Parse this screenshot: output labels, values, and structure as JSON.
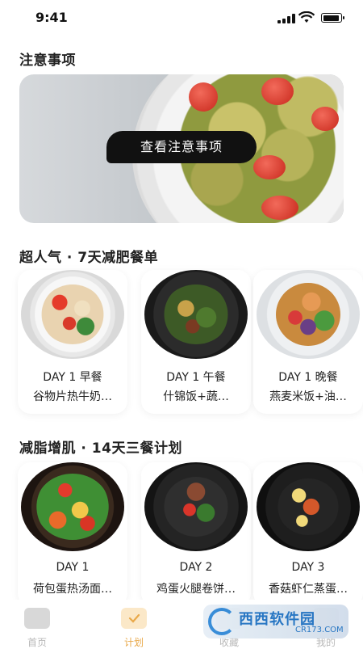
{
  "status": {
    "time": "9:41"
  },
  "notice": {
    "title": "注意事项",
    "button": "查看注意事项"
  },
  "section1": {
    "title": "超人气 · 7天减肥餐单",
    "cards": [
      {
        "day": "DAY 1 早餐",
        "desc": "谷物片热牛奶…"
      },
      {
        "day": "DAY 1 午餐",
        "desc": "什锦饭+蔬…"
      },
      {
        "day": "DAY 1 晚餐",
        "desc": "燕麦米饭+油…"
      }
    ]
  },
  "section2": {
    "title": "减脂增肌 · 14天三餐计划",
    "cards": [
      {
        "day": "DAY 1",
        "desc": "荷包蛋热汤面…"
      },
      {
        "day": "DAY 2",
        "desc": "鸡蛋火腿卷饼…"
      },
      {
        "day": "DAY 3",
        "desc": "香菇虾仁蒸蛋…"
      }
    ]
  },
  "tabs": [
    {
      "label": "首页",
      "icon": "home-icon",
      "active": false
    },
    {
      "label": "计划",
      "icon": "plan-check-icon",
      "active": true
    },
    {
      "label": "收藏",
      "icon": "favorite-icon",
      "active": false
    },
    {
      "label": "我的",
      "icon": "profile-icon",
      "active": false
    }
  ],
  "watermark": {
    "name": "西西软件园",
    "url": "CR173.COM"
  },
  "colors": {
    "accent": "#e9a94a",
    "button_bg": "#111111",
    "tab_inactive": "#b9b9b9"
  }
}
